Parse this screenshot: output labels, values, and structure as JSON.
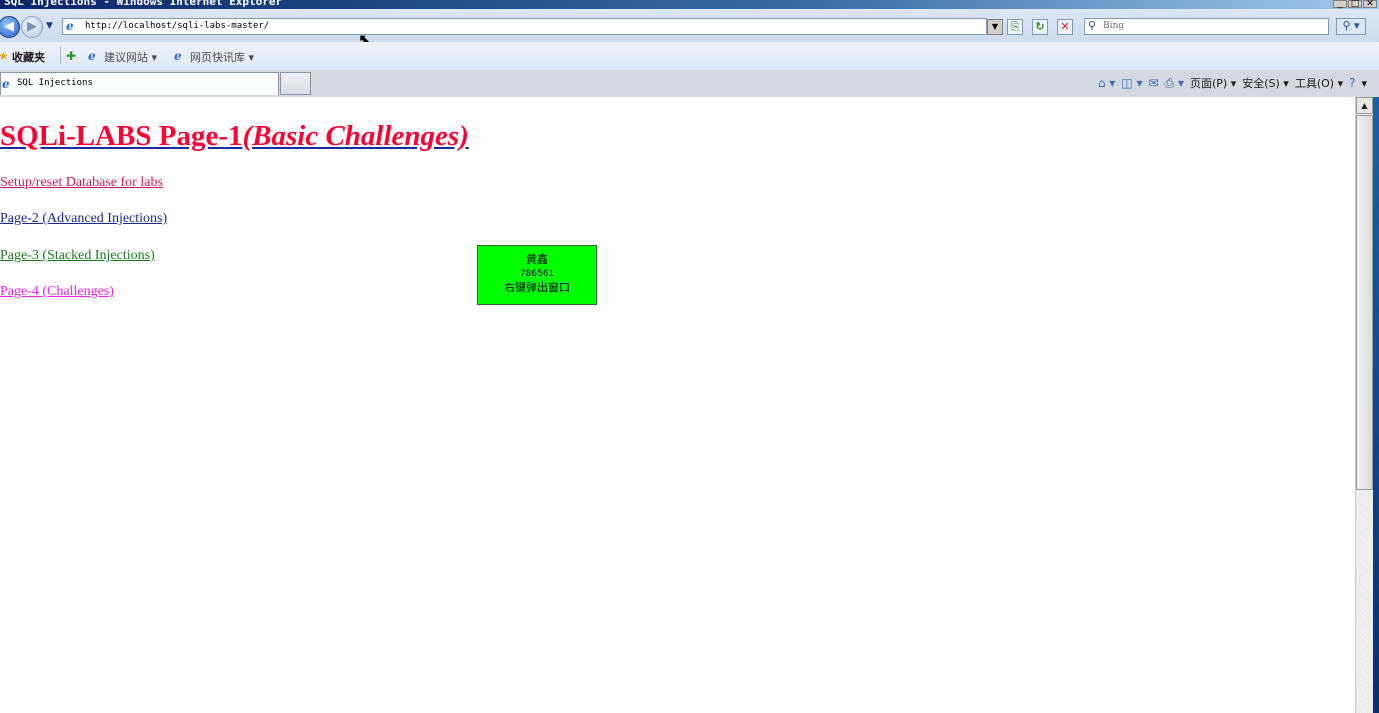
{
  "window": {
    "title": "SQL Injections - Windows Internet Explorer",
    "controls": [
      "_",
      "□",
      "✕"
    ]
  },
  "toolbar": {
    "address": "http://localhost/sqli-labs-master/",
    "search_placeholder": "Bing"
  },
  "favorites": {
    "label": "收藏夹",
    "items": [
      {
        "label": "建议网站 ▾"
      },
      {
        "label": "网页快讯库 ▾"
      }
    ]
  },
  "tabs": {
    "active_label": "SQL Injections"
  },
  "command_bar": {
    "page": "页面(P) ▾",
    "safety": "安全(S) ▾",
    "tools": "工具(O) ▾",
    "help": "▾"
  },
  "page": {
    "heading_main": "SQLi-LABS Page-1",
    "heading_italic": "(Basic Challenges)",
    "links": [
      "Setup/reset Database for labs",
      "Page-2 (Advanced Injections)",
      "Page-3 (Stacked Injections)",
      "Page-4 (Challenges)"
    ]
  },
  "popup": {
    "line1": "黄鑫",
    "line2": "786561",
    "line3": "右键弹出窗口"
  },
  "colors": {
    "heading": "#ff0033",
    "popup_bg": "#00ff00"
  }
}
